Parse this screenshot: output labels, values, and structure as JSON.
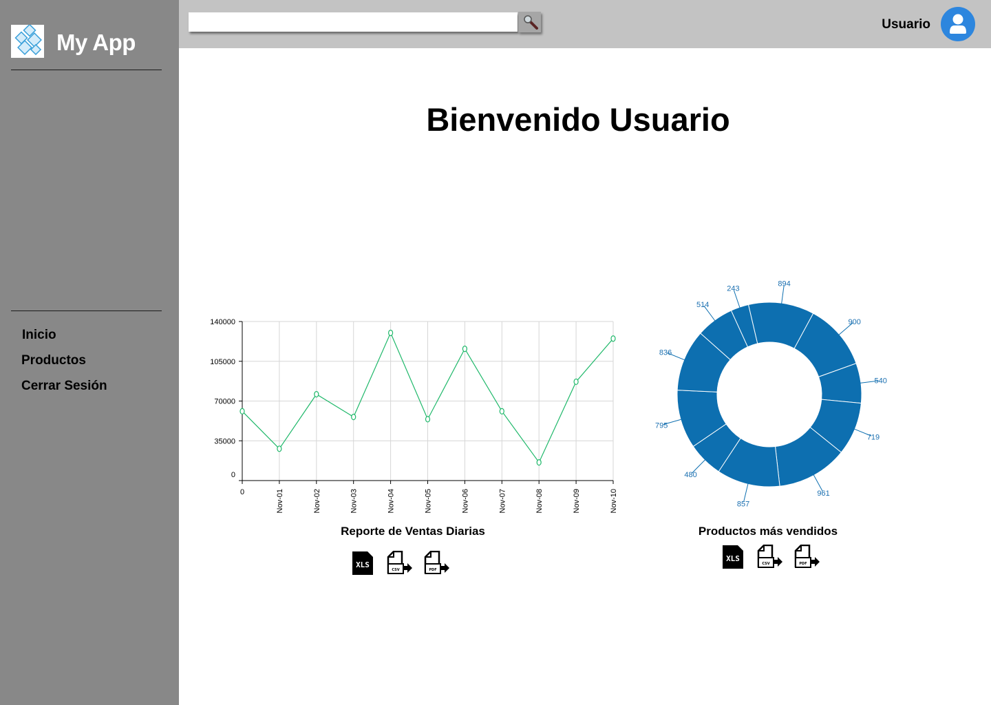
{
  "app": {
    "name": "My App"
  },
  "sidebar": {
    "items": [
      {
        "label": "Inicio"
      },
      {
        "label": "Productos"
      },
      {
        "label": "Cerrar Sesión"
      }
    ]
  },
  "header": {
    "search": {
      "value": "",
      "placeholder": ""
    },
    "user_name": "Usuario"
  },
  "main": {
    "title": "Bienvenido Usuario"
  },
  "icons": {
    "logo": "diamond-tiles-logo",
    "search": "magnifier-icon",
    "avatar": "user-avatar-icon",
    "exports": [
      "xls-file-icon",
      "csv-export-icon",
      "pdf-export-icon"
    ]
  },
  "colors": {
    "sidebar": "#888888",
    "topbar": "#c3c3c3",
    "accent": "#2d86de",
    "line": "#1fb86a",
    "donut": "#0d6fb0"
  },
  "chart_data": [
    {
      "type": "line",
      "caption": "Reporte de Ventas Diarias",
      "x": [
        "0",
        "Nov-01",
        "Nov-02",
        "Nov-03",
        "Nov-04",
        "Nov-05",
        "Nov-06",
        "Nov-07",
        "Nov-08",
        "Nov-09",
        "Nov-10"
      ],
      "values": [
        61000,
        28000,
        76000,
        56000,
        130000,
        54000,
        116000,
        61000,
        16000,
        87000,
        125000
      ],
      "yticks": [
        0,
        35000,
        70000,
        105000,
        140000
      ],
      "ylim": [
        0,
        140000
      ],
      "grid": true
    },
    {
      "type": "pie",
      "variant": "donut",
      "caption": "Productos más vendidos",
      "values": [
        894,
        900,
        540,
        719,
        961,
        857,
        480,
        795,
        836,
        514,
        243
      ]
    }
  ]
}
